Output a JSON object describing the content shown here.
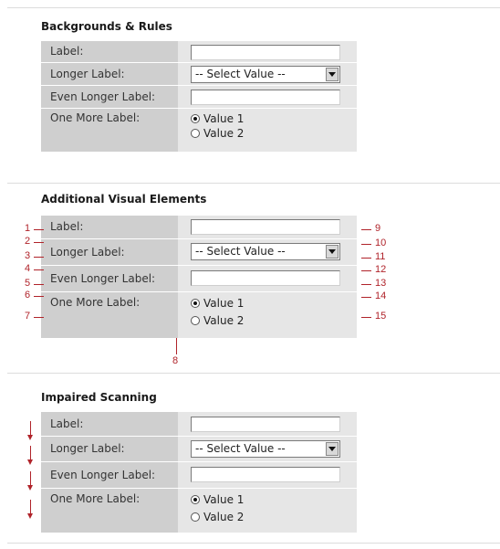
{
  "sections": [
    {
      "title": "Backgrounds & Rules",
      "rows": [
        {
          "label": "Label:"
        },
        {
          "label": "Longer Label:",
          "select": "-- Select Value --"
        },
        {
          "label": "Even Longer Label:"
        },
        {
          "label": "One More Label:",
          "radio1": "Value 1",
          "radio2": "Value 2"
        }
      ]
    },
    {
      "title": "Additional Visual Elements",
      "rows": [
        {
          "label": "Label:"
        },
        {
          "label": "Longer Label:",
          "select": "-- Select Value --"
        },
        {
          "label": "Even Longer Label:"
        },
        {
          "label": "One More Label:",
          "radio1": "Value 1",
          "radio2": "Value 2"
        }
      ],
      "left_markers": [
        "1",
        "2",
        "3",
        "4",
        "5",
        "6",
        "7"
      ],
      "bottom_marker": "8",
      "right_markers": [
        "9",
        "10",
        "11",
        "12",
        "13",
        "14",
        "15"
      ]
    },
    {
      "title": "Impaired Scanning",
      "rows": [
        {
          "label": "Label:"
        },
        {
          "label": "Longer Label:",
          "select": "-- Select Value --"
        },
        {
          "label": "Even Longer Label:"
        },
        {
          "label": "One More Label:",
          "radio1": "Value 1",
          "radio2": "Value 2"
        }
      ]
    }
  ],
  "colors": {
    "label_bg": "#cfcfcf",
    "control_bg": "#e6e6e6",
    "annotation": "#b0232a"
  }
}
